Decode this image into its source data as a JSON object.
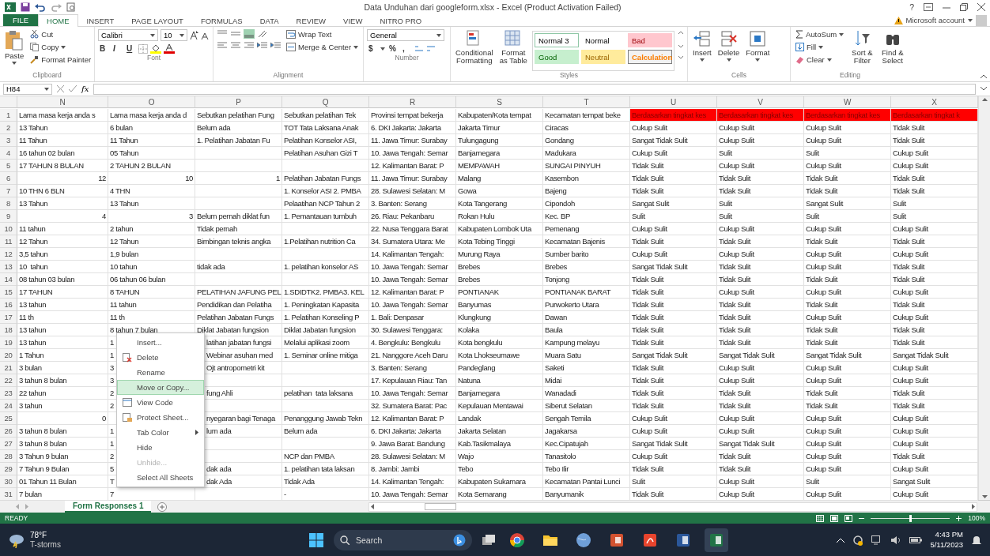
{
  "title_bar": {
    "title": "Data Unduhan dari googleform.xlsx - Excel (Product Activation Failed)",
    "help": "?",
    "account": "Microsoft account"
  },
  "ribbon_tabs": [
    {
      "label": "FILE",
      "kind": "file",
      "selected": false
    },
    {
      "label": "HOME",
      "kind": "tab",
      "selected": true
    },
    {
      "label": "INSERT",
      "kind": "tab",
      "selected": false
    },
    {
      "label": "PAGE LAYOUT",
      "kind": "tab",
      "selected": false
    },
    {
      "label": "FORMULAS",
      "kind": "tab",
      "selected": false
    },
    {
      "label": "DATA",
      "kind": "tab",
      "selected": false
    },
    {
      "label": "REVIEW",
      "kind": "tab",
      "selected": false
    },
    {
      "label": "VIEW",
      "kind": "tab",
      "selected": false
    },
    {
      "label": "NITRO PRO",
      "kind": "tab",
      "selected": false
    }
  ],
  "clipboard": {
    "paste": "Paste",
    "cut": "Cut",
    "copy": "Copy",
    "format_painter": "Format Painter",
    "label": "Clipboard"
  },
  "font": {
    "name": "Calibri",
    "size": "10",
    "bold": "B",
    "italic": "I",
    "underline": "U",
    "label": "Font"
  },
  "alignment": {
    "wrap_text": "Wrap Text",
    "merge_center": "Merge & Center",
    "label": "Alignment"
  },
  "number": {
    "format": "General",
    "currency": "$",
    "percent": "%",
    "comma": ",",
    "label": "Number"
  },
  "styles": {
    "conditional_formatting": "Conditional Formatting",
    "format_as_table": "Format as Table",
    "label": "Styles",
    "gallery": [
      {
        "name": "Normal 3",
        "kind": "normal3"
      },
      {
        "name": "Normal",
        "kind": "normal"
      },
      {
        "name": "Bad",
        "kind": "bad"
      },
      {
        "name": "Good",
        "kind": "good"
      },
      {
        "name": "Neutral",
        "kind": "neutral"
      },
      {
        "name": "Calculation",
        "kind": "calculation"
      }
    ]
  },
  "cells": {
    "label": "Cells",
    "buttons": [
      {
        "label": "Insert",
        "kind": "insert"
      },
      {
        "label": "Delete",
        "kind": "delete"
      },
      {
        "label": "Format",
        "kind": "format"
      }
    ]
  },
  "editing": {
    "autosum": "AutoSum",
    "fill": "Fill",
    "clear": "Clear",
    "sort_filter": "Sort & Filter",
    "find_select": "Find & Select",
    "label": "Editing"
  },
  "formula_bar": {
    "name_box": "H84",
    "function_label": "fx"
  },
  "sheet": {
    "columns": [
      "N",
      "O",
      "P",
      "Q",
      "R",
      "S",
      "T",
      "U",
      "V",
      "W",
      "X"
    ],
    "header_row": {
      "number": "1",
      "cells": [
        {
          "text": "Lama masa kerja anda s",
          "highlighted": false
        },
        {
          "text": "Lama masa kerja anda d",
          "highlighted": false
        },
        {
          "text": "Sebutkan pelatihan Fung",
          "highlighted": false
        },
        {
          "text": "Sebutkan pelatihan Tek",
          "highlighted": false
        },
        {
          "text": "Provinsi tempat bekerja",
          "highlighted": false
        },
        {
          "text": "Kabupaten/Kota tempat",
          "highlighted": false
        },
        {
          "text": "Kecamatan tempat beke",
          "highlighted": false
        },
        {
          "text": "Berdasarkan tingkat kes",
          "highlighted": true
        },
        {
          "text": "Berdasarkan tingkat kes",
          "highlighted": true
        },
        {
          "text": "Berdasarkan tingkat kes",
          "highlighted": true
        },
        {
          "text": "Berdasarkan tingkat k",
          "highlighted": true
        }
      ]
    },
    "rows": [
      {
        "number": "2",
        "cells": [
          "13 Tahun",
          "6 bulan",
          "Belum ada",
          "TOT Tata Laksana Anak",
          "6. DKI Jakarta: Jakarta",
          "Jakarta Timur",
          "Ciracas",
          "Cukup Sulit",
          "Cukup Sulit",
          "Cukup Sulit",
          "Tidak Sulit"
        ]
      },
      {
        "number": "3",
        "cells": [
          "11 Tahun",
          "11 Tahun",
          "1. Pelatihan Jabatan Fu",
          "Pelatihan Konselor ASI,",
          "11. Jawa Timur: Surabay",
          "Tulungagung",
          "Gondang",
          "Sangat Tidak Sulit",
          "Cukup Sulit",
          "Cukup Sulit",
          "Tidak Sulit"
        ]
      },
      {
        "number": "4",
        "cells": [
          "16 tahun 02 bulan",
          "05 Tahun",
          "",
          "Pelatihan Asuhan Gizi T",
          "10. Jawa Tengah: Semar",
          "Banjarnegara",
          "Madukara",
          "Cukup Sulit",
          "Sulit",
          "Sulit",
          "Cukup Sulit"
        ]
      },
      {
        "number": "5",
        "cells": [
          "17 TAHUN 8 BULAN",
          "2 TAHUN 2 BULAN",
          "",
          "",
          "12. Kalimantan Barat: P",
          "MEMPAWAH",
          "SUNGAI PINYUH",
          "Tidak Sulit",
          "Cukup Sulit",
          "Cukup Sulit",
          "Cukup Sulit"
        ]
      },
      {
        "number": "6",
        "cells": [
          "12",
          "10",
          "1",
          "Pelatihan Jabatan Fungs",
          "11. Jawa Timur: Surabay",
          "Malang",
          "Kasembon",
          "Tidak Sulit",
          "Tidak Sulit",
          "Tidak Sulit",
          "Tidak Sulit"
        ]
      },
      {
        "number": "7",
        "cells": [
          "10 THN 6 BLN",
          "4 THN",
          "",
          "1. Konselor ASI 2. PMBA",
          "28. Sulawesi Selatan: M",
          "Gowa",
          "Bajeng",
          "Tidak Sulit",
          "Tidak Sulit",
          "Tidak Sulit",
          "Tidak Sulit"
        ]
      },
      {
        "number": "8",
        "cells": [
          "13 Tahun",
          "13 Tahun",
          "",
          "Pelaatihan NCP Tahun 2",
          "3. Banten: Serang",
          "Kota Tangerang",
          "Cipondoh",
          "Sangat Sulit",
          "Sulit",
          "Sangat Sulit",
          "Sulit"
        ]
      },
      {
        "number": "9",
        "cells": [
          "4",
          "3",
          "Belum pernah diklat fun",
          "1. Pemantauan tumbuh",
          "26. Riau: Pekanbaru",
          "Rokan Hulu",
          "Kec. BP",
          "Sulit",
          "Sulit",
          "Sulit",
          "Sulit"
        ]
      },
      {
        "number": "10",
        "cells": [
          "11 tahun",
          "2 tahun",
          "Tidak pernah",
          "",
          "22. Nusa Tenggara Barat",
          "Kabupaten Lombok Uta",
          "Pemenang",
          "Cukup Sulit",
          "Cukup Sulit",
          "Cukup Sulit",
          "Cukup Sulit"
        ]
      },
      {
        "number": "11",
        "cells": [
          "12 Tahun",
          "12 Tahun",
          "Bimbingan teknis angka",
          "1.Pelatihan nutrition Ca",
          "34. Sumatera Utara: Me",
          "Kota Tebing Tinggi",
          "Kecamatan Bajenis",
          "Tidak Sulit",
          "Tidak Sulit",
          "Tidak Sulit",
          "Tidak Sulit"
        ]
      },
      {
        "number": "12",
        "cells": [
          "3,5 tahun",
          "1,9 bulan",
          "",
          "",
          "14. Kalimantan Tengah:",
          "Murung Raya",
          "Sumber barito",
          "Cukup Sulit",
          "Cukup Sulit",
          "Cukup Sulit",
          "Cukup Sulit"
        ]
      },
      {
        "number": "13",
        "cells": [
          "10  tahun",
          "10 tahun",
          "tidak ada",
          "1. pelatihan konselor AS",
          "10. Jawa Tengah: Semar",
          "Brebes",
          "Brebes",
          "Sangat Tidak Sulit",
          "Tidak Sulit",
          "Cukup Sulit",
          "Tidak Sulit"
        ]
      },
      {
        "number": "14",
        "cells": [
          "08 tahun 03 bulan",
          "06 tahun 06 bulan",
          "",
          "",
          "10. Jawa Tengah: Semar",
          "Brebes",
          "Tonjong",
          "Tidak Sulit",
          "Tidak Sulit",
          "Tidak Sulit",
          "Tidak Sulit"
        ]
      },
      {
        "number": "15",
        "cells": [
          "17 TAHUN",
          "8 TAHUN",
          "PELATIHAN JAFUNG PEL",
          "1.SDIDTK2. PMBA3. KEL",
          "12. Kalimantan Barat: P",
          "PONTIANAK",
          "PONTIANAK BARAT",
          "Tidak Sulit",
          "Cukup Sulit",
          "Cukup Sulit",
          "Cukup Sulit"
        ]
      },
      {
        "number": "16",
        "cells": [
          "13 tahun",
          "11 tahun",
          "Pendidikan dan Pelatiha",
          "1. Peningkatan Kapasita",
          "10. Jawa Tengah: Semar",
          "Banyumas",
          "Purwokerto Utara",
          "Tidak Sulit",
          "Tidak Sulit",
          "Tidak Sulit",
          "Tidak Sulit"
        ]
      },
      {
        "number": "17",
        "cells": [
          "11 th",
          "11 th",
          "Pelatihan Jabatan Fungs",
          "1. Pelatihan Konseling P",
          "1. Bali: Denpasar",
          "Klungkung",
          "Dawan",
          "Tidak Sulit",
          "Tidak Sulit",
          "Cukup Sulit",
          "Cukup Sulit"
        ]
      },
      {
        "number": "18",
        "cells": [
          "13 tahun",
          "8 tahun 7 bulan",
          "Diklat Jabatan fungsion",
          "Diklat Jabatan fungsion",
          "30. Sulawesi Tenggara:",
          "Kolaka",
          "Baula",
          "Tidak Sulit",
          "Tidak Sulit",
          "Tidak Sulit",
          "Tidak Sulit"
        ]
      },
      {
        "number": "19",
        "cells": [
          "13 tahun",
          "1",
          "latihan jabatan fungsi",
          "Melalui aplikasi zoom",
          "4. Bengkulu: Bengkulu",
          "Kota bengkulu",
          "Kampung melayu",
          "Tidak Sulit",
          "Tidak Sulit",
          "Tidak Sulit",
          "Tidak Sulit"
        ]
      },
      {
        "number": "20",
        "cells": [
          "1 Tahun",
          "1",
          "Webinar asuhan med",
          "1. Seminar online mitiga",
          "21. Nanggore Aceh Daru",
          "Kota Lhokseumawe",
          "Muara Satu",
          "Sangat Tidak Sulit",
          "Sangat Tidak Sulit",
          "Sangat Tidak Sulit",
          "Sangat Tidak Sulit"
        ]
      },
      {
        "number": "21",
        "cells": [
          "3 bulan",
          "3",
          "Ojt antropometri kit",
          "",
          "3. Banten: Serang",
          "Pandeglang",
          "Saketi",
          "Tidak Sulit",
          "Cukup Sulit",
          "Cukup Sulit",
          "Cukup Sulit"
        ]
      },
      {
        "number": "22",
        "cells": [
          "3 tahun 8 bulan",
          "3",
          "",
          "",
          "17. Kepulauan Riau: Tan",
          "Natuna",
          "Midai",
          "Tidak Sulit",
          "Cukup Sulit",
          "Cukup Sulit",
          "Cukup Sulit"
        ]
      },
      {
        "number": "23",
        "cells": [
          "22 tahun",
          "2",
          "fung Ahli",
          "pelatihan  tata laksana",
          "10. Jawa Tengah: Semar",
          "Banjarnegara",
          "Wanadadi",
          "Tidak Sulit",
          "Tidak Sulit",
          "Tidak Sulit",
          "Tidak Sulit"
        ]
      },
      {
        "number": "24",
        "cells": [
          "3 tahun",
          "2",
          "",
          "",
          "32. Sumatera Barat: Pac",
          "Kepulauan Mentawai",
          "Siberut Selatan",
          "Tidak Sulit",
          "Tidak Sulit",
          "Tidak Sulit",
          "Tidak Sulit"
        ]
      },
      {
        "number": "25",
        "cells": [
          "0",
          "",
          "nyegaran bagi Tenaga",
          "Penanggung Jawab Tekn",
          "12. Kalimantan Barat: P",
          "Landak",
          "Sengah Temila",
          "Cukup Sulit",
          "Cukup Sulit",
          "Cukup Sulit",
          "Cukup Sulit"
        ]
      },
      {
        "number": "26",
        "cells": [
          "3 tahun 8 bulan",
          "1",
          "lum ada",
          "Belum ada",
          "6. DKI Jakarta: Jakarta",
          "Jakarta Selatan",
          "Jagakarsa",
          "Cukup Sulit",
          "Cukup Sulit",
          "Cukup Sulit",
          "Cukup Sulit"
        ]
      },
      {
        "number": "27",
        "cells": [
          "3 tahun 8 bulan",
          "1",
          "",
          "",
          "9. Jawa Barat: Bandung",
          "Kab.Tasikmalaya",
          "Kec.Cipatujah",
          "Sangat Tidak Sulit",
          "Sangat Tidak Sulit",
          "Cukup Sulit",
          "Cukup Sulit"
        ]
      },
      {
        "number": "28",
        "cells": [
          "3 Tahun 9 bulan",
          "2",
          "",
          "NCP dan PMBA",
          "28. Sulawesi Selatan: M",
          "Wajo",
          "Tanasitolo",
          "Cukup Sulit",
          "Tidak Sulit",
          "Cukup Sulit",
          "Tidak Sulit"
        ]
      },
      {
        "number": "29",
        "cells": [
          "7 Tahun 9 Bulan",
          "5",
          "dak ada",
          "1. pelatihan tata laksan",
          "8. Jambi: Jambi",
          "Tebo",
          "Tebo Ilir",
          "Tidak Sulit",
          "Tidak Sulit",
          "Cukup Sulit",
          "Cukup Sulit"
        ]
      },
      {
        "number": "30",
        "cells": [
          "01 Tahun 11 Bulan",
          "T",
          "dak Ada",
          "Tidak Ada",
          "14. Kalimantan Tengah:",
          "Kabupaten Sukamara",
          "Kecamatan Pantai Lunci",
          "Sulit",
          "Cukup Sulit",
          "Sulit",
          "Sangat Sulit"
        ]
      },
      {
        "number": "31",
        "cells": [
          "7 bulan",
          "7",
          "",
          "-",
          "10. Jawa Tengah: Semar",
          "Kota Semarang",
          "Banyumanik",
          "Tidak Sulit",
          "Cukup Sulit",
          "Cukup Sulit",
          "Cukup Sulit"
        ]
      }
    ]
  },
  "context_menu": {
    "items": [
      {
        "label": "Insert...",
        "kind": "plain",
        "selected": false,
        "disabled": false
      },
      {
        "label": "Delete",
        "kind": "delete",
        "selected": false,
        "disabled": false
      },
      {
        "label": "Rename",
        "kind": "plain",
        "selected": false,
        "disabled": false
      },
      {
        "label": "Move or Copy...",
        "kind": "plain",
        "selected": true,
        "disabled": false
      },
      {
        "label": "View Code",
        "kind": "code",
        "selected": false,
        "disabled": false
      },
      {
        "label": "Protect Sheet...",
        "kind": "protect",
        "selected": false,
        "disabled": false
      },
      {
        "label": "Tab Color",
        "kind": "submenu",
        "selected": false,
        "disabled": false
      },
      {
        "label": "Hide",
        "kind": "plain",
        "selected": false,
        "disabled": false
      },
      {
        "label": "Unhide...",
        "kind": "plain",
        "selected": false,
        "disabled": true
      },
      {
        "label": "Select All Sheets",
        "kind": "plain",
        "selected": false,
        "disabled": false
      }
    ]
  },
  "sheet_tabs": [
    {
      "label": "Form Responses 1",
      "selected": true
    }
  ],
  "status_bar": {
    "status": "READY",
    "zoom": "100%",
    "zoom_slider": {
      "level": 0.5
    }
  },
  "taskbar": {
    "temperature": "78°F",
    "weather": "T-storms",
    "search": "Search",
    "time": "4:43 PM",
    "date": "5/11/2023",
    "apps": [
      {
        "kind": "browser",
        "selected": false
      },
      {
        "kind": "folder",
        "selected": false
      },
      {
        "kind": "globe",
        "selected": false
      },
      {
        "kind": "slides",
        "selected": false
      },
      {
        "kind": "pdf",
        "selected": false
      },
      {
        "kind": "document",
        "selected": false
      },
      {
        "kind": "spreadsheet",
        "selected": true
      }
    ]
  }
}
